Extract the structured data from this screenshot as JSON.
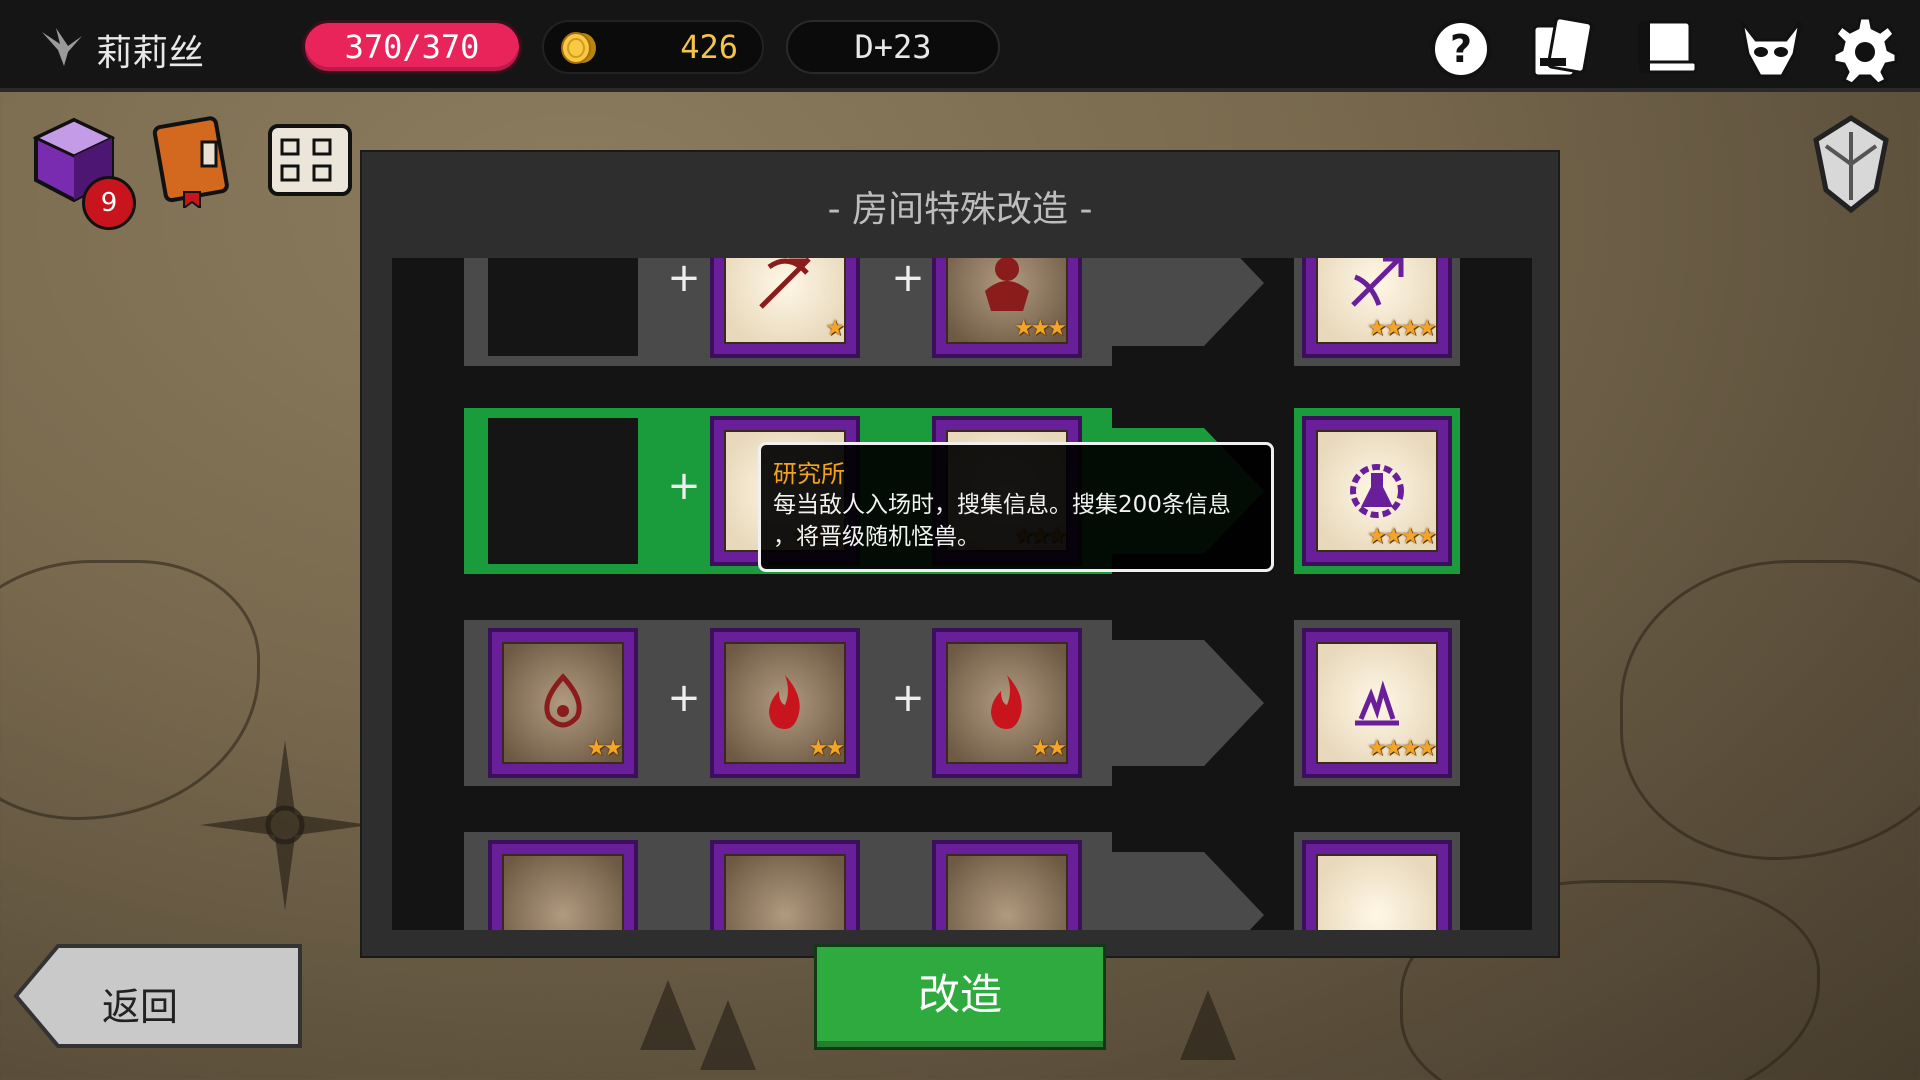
{
  "player": {
    "name": "莉莉丝"
  },
  "stats": {
    "hp": "370/370",
    "gold": "426",
    "day": "D+23"
  },
  "top_icons": [
    "help-icon",
    "cards-icon",
    "book-icon",
    "demon-mask-icon",
    "gear-icon"
  ],
  "inventory": {
    "cube_badge": "9"
  },
  "panel": {
    "title": "-  房间特殊改造  -"
  },
  "plus_sign": "+",
  "rows": [
    {
      "slots": [
        "empty",
        "ballista-icon",
        "ogre-icon"
      ],
      "stars": [
        "",
        "★",
        "★★★"
      ],
      "result": "crossbow-icon",
      "result_stars": "★★★★"
    },
    {
      "slots": [
        "empty",
        "card",
        "card"
      ],
      "stars": [
        "",
        "★★★",
        "★★★"
      ],
      "result": "laboratory-icon",
      "result_stars": "★★★★",
      "active": true
    },
    {
      "slots": [
        "poison-icon",
        "fire-icon",
        "fire-icon"
      ],
      "stars": [
        "★★",
        "★★",
        "★★"
      ],
      "result": "bonfire-icon",
      "result_stars": "★★★★"
    }
  ],
  "tooltip": {
    "title": "研究所",
    "line1": "每当敌人入场时，搜集信息。搜集200条信息",
    "line2": "，将晋级随机怪兽。"
  },
  "buttons": {
    "back": "返回",
    "modify": "改造"
  },
  "colors": {
    "hp": "#e8245a",
    "active_row": "#1a9c3c",
    "modify_button": "#2faa3e",
    "card_frame": "#6a1f9a",
    "star": "#f2a526",
    "tooltip_title": "#f3a31a"
  }
}
